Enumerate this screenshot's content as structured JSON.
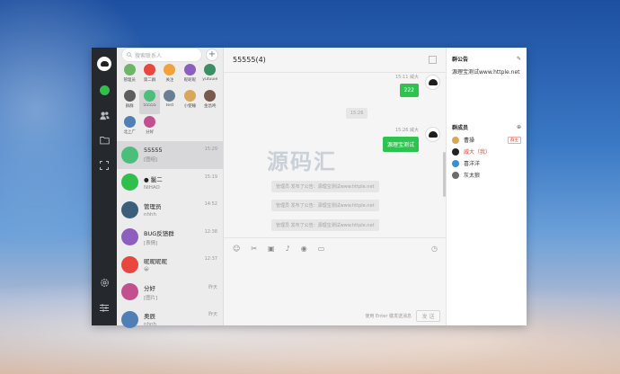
{
  "window": {
    "title": "55555(4)"
  },
  "search": {
    "placeholder": "搜索联系人"
  },
  "group_grid": [
    {
      "label": "管理员",
      "color": "#6fb567"
    },
    {
      "label": "第二群",
      "color": "#e8463e"
    },
    {
      "label": "关注",
      "color": "#f0a23b"
    },
    {
      "label": "昵昵昵",
      "color": "#8c5fbf"
    },
    {
      "label": "yutuuie",
      "color": "#3a8f65"
    },
    {
      "label": "群群",
      "color": "#5d5d5d"
    },
    {
      "label": "55555",
      "color": "#4bbf7a"
    },
    {
      "label": "test",
      "color": "#6b7e92"
    },
    {
      "label": "小使睡",
      "color": "#d9a75a"
    },
    {
      "label": "金昌咚",
      "color": "#7a5a4c"
    },
    {
      "label": "北上广",
      "color": "#4f7fb5"
    },
    {
      "label": "分好",
      "color": "#c24f8e"
    }
  ],
  "contacts": [
    {
      "name": "55555",
      "sub": "[图组]",
      "time": "15:29",
      "color": "#4bbf7a"
    },
    {
      "name": "● 鬣二",
      "sub": "NIHAO",
      "time": "15:19",
      "color": "#2ec04a"
    },
    {
      "name": "管理员",
      "sub": "nhhh",
      "time": "14:52",
      "color": "#3b5f7a"
    },
    {
      "name": "BUG反馈群",
      "sub": "[表情]",
      "time": "12:38",
      "color": "#8c5fbf"
    },
    {
      "name": "昵昵昵昵",
      "sub": "😀",
      "time": "12:37",
      "color": "#e8463e"
    },
    {
      "name": "分好",
      "sub": "[图片]",
      "time": "昨天",
      "color": "#c24f8e"
    },
    {
      "name": "奥辰",
      "sub": "nhnh",
      "time": "昨天",
      "color": "#4f7fb5"
    }
  ],
  "messages": {
    "m1_meta": "15:11 威大",
    "m1_text": "222",
    "divider_time": "15:26",
    "m2_meta": "15:26 威大",
    "m2_text": "源理宝测试",
    "sys1": "管理员 发布了公告：源理宝测试www.httple.net",
    "sys2": "管理员 发布了公告：源理宝测试www.httple.net",
    "sys3": "管理员 发布了公告：源理宝测试www.httple.net"
  },
  "composer": {
    "hint": "使用 Enter 键发送消息",
    "send_label": "发 送"
  },
  "side": {
    "notice_title": "群公告",
    "notice_text": "源理宝测试www.httple.net",
    "members_title": "群成员",
    "members": [
      {
        "name": "曹操",
        "color": "#d9a75a",
        "badge": "群主",
        "highlight": false
      },
      {
        "name": "威大（我）",
        "color": "#222222",
        "badge": "",
        "highlight": true
      },
      {
        "name": "喜洋洋",
        "color": "#3a8fd1",
        "badge": "",
        "highlight": false
      },
      {
        "name": "灰太狼",
        "color": "#6b6b6b",
        "badge": "",
        "highlight": false
      }
    ]
  },
  "watermark": "源码汇"
}
